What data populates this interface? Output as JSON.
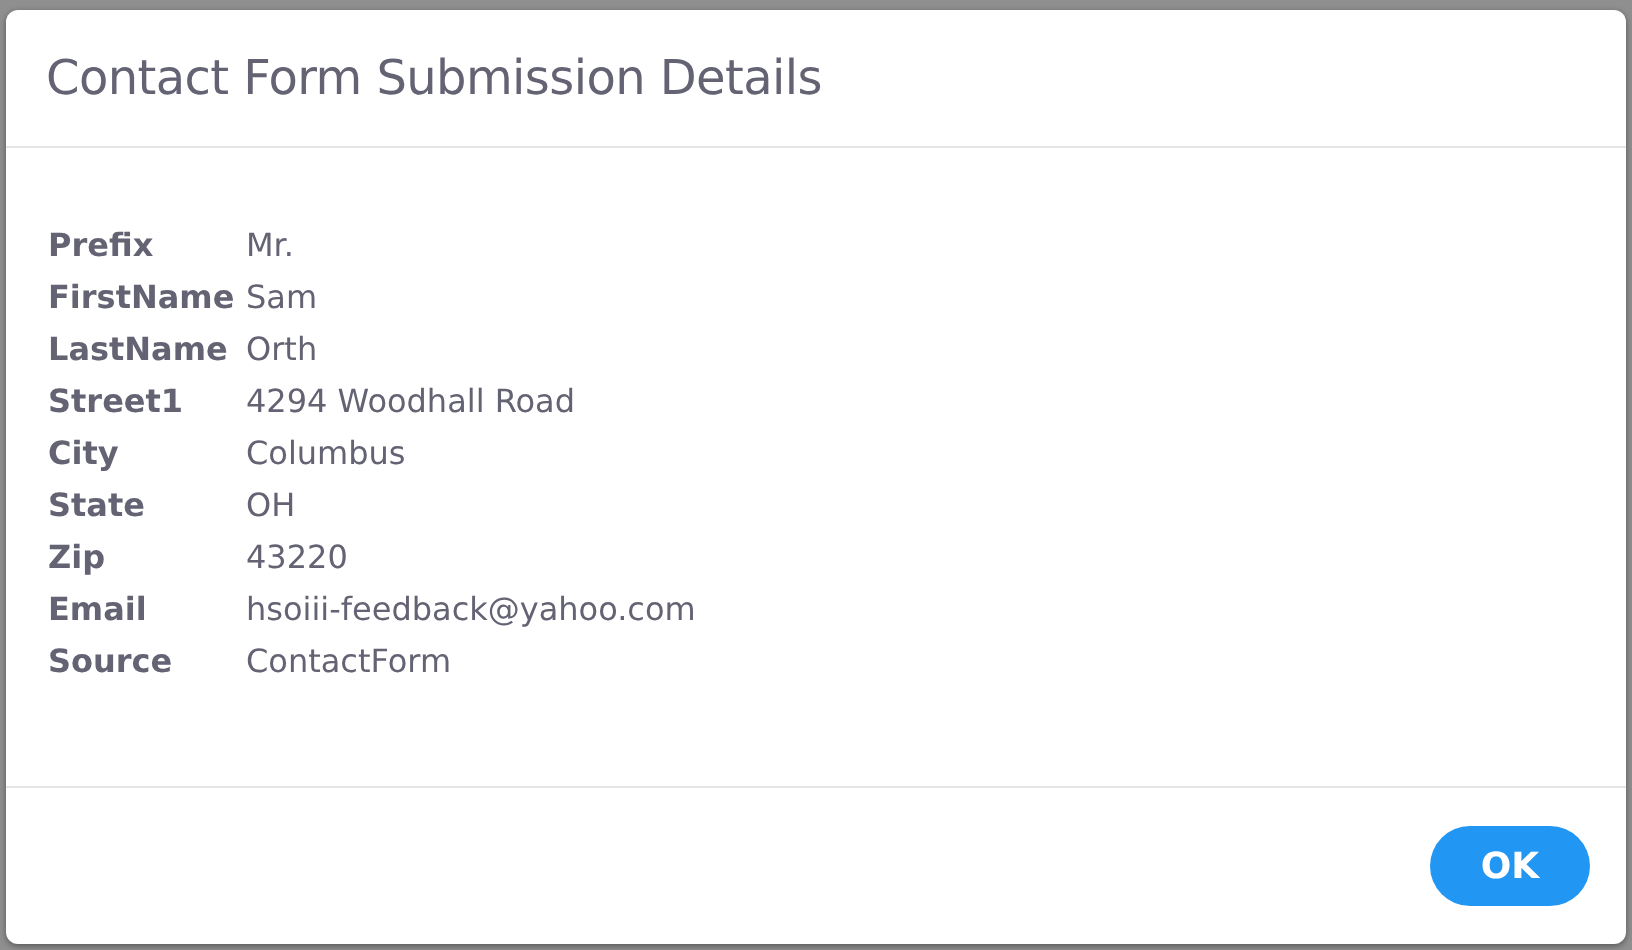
{
  "dialog": {
    "title": "Contact Form Submission Details",
    "fields": [
      {
        "label": "Prefix",
        "value": "Mr."
      },
      {
        "label": "FirstName",
        "value": "Sam"
      },
      {
        "label": "LastName",
        "value": "Orth"
      },
      {
        "label": "Street1",
        "value": "4294 Woodhall Road"
      },
      {
        "label": "City",
        "value": "Columbus"
      },
      {
        "label": "State",
        "value": "OH"
      },
      {
        "label": "Zip",
        "value": "43220"
      },
      {
        "label": "Email",
        "value": "hsoiii-feedback@yahoo.com"
      },
      {
        "label": "Source",
        "value": "ContactForm"
      }
    ],
    "buttons": [
      {
        "label": "OK"
      }
    ]
  }
}
